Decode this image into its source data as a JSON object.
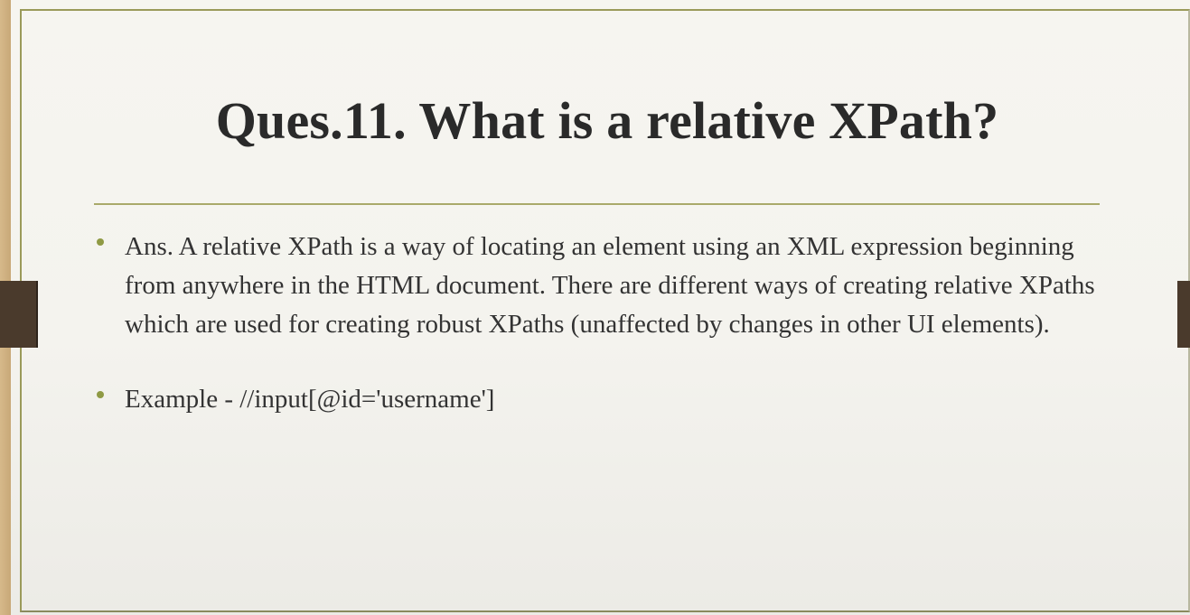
{
  "slide": {
    "title": "Ques.11. What is a relative XPath?",
    "bullets": [
      "Ans. A relative XPath is a way of locating an element using an XML expression beginning from anywhere in the HTML document. There are different ways of creating relative XPaths which are used for creating robust XPaths (unaffected by changes in other UI elements).",
      "Example - //input[@id='username']"
    ]
  },
  "colors": {
    "accent": "#8f9a44",
    "frame": "#9a9a5a",
    "title_text": "#2a2a2a",
    "body_text": "#333333"
  }
}
